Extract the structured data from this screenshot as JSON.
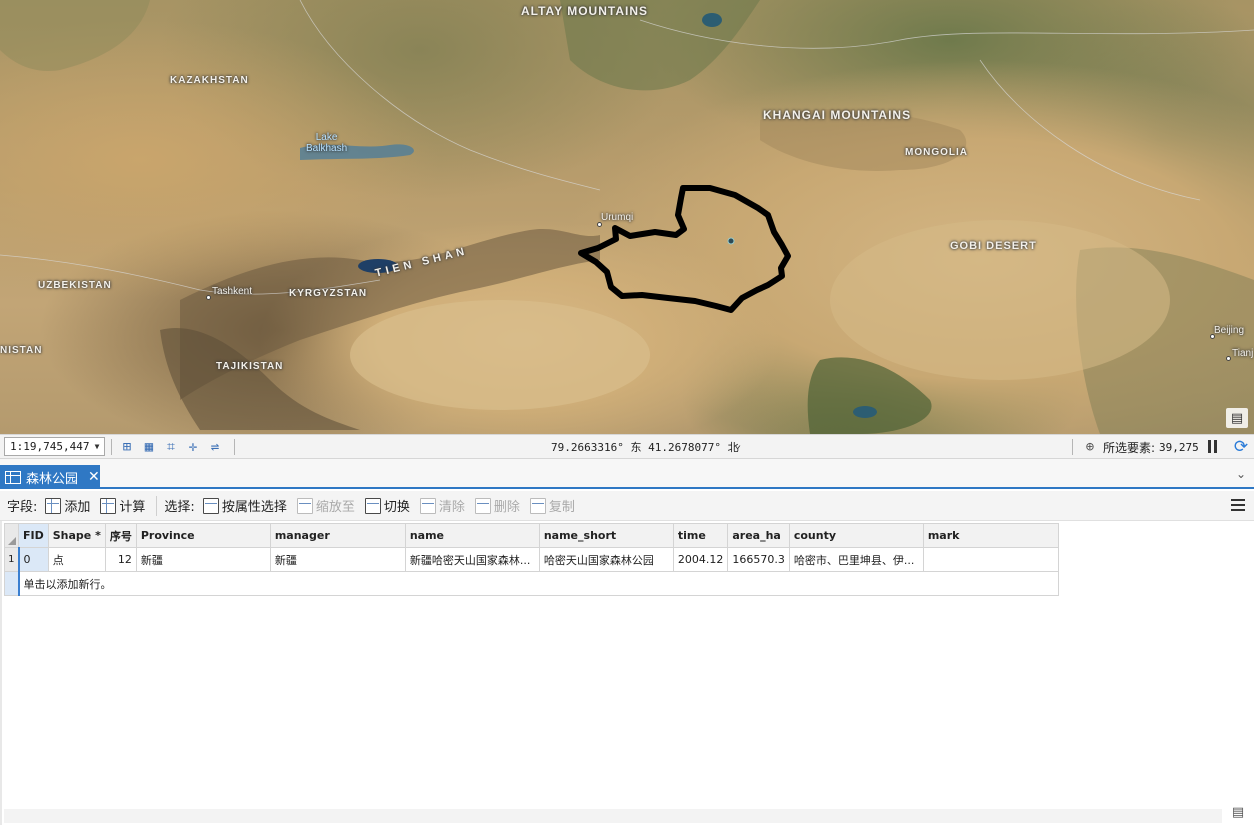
{
  "map": {
    "labels": {
      "altay": "ALTAY MOUNTAINS",
      "kazakhstan": "KAZAKHSTAN",
      "lake_balkhash": "Lake\nBalkhash",
      "khangai": "KHANGAI MOUNTAINS",
      "mongolia": "MONGOLIA",
      "urumqi": "Urumqi",
      "gobi": "GOBI DESERT",
      "uzbekistan": "UZBEKISTAN",
      "tashkent": "Tashkent",
      "kyrgyzstan": "KYRGYZSTAN",
      "tien_shan": "TIEN SHAN",
      "nistan": "NISTAN",
      "tajikistan": "TAJIKISTAN",
      "beijing": "Beijing",
      "tianjin": "Tianj"
    },
    "corner_icon": "table-view-icon",
    "polygon_color": "#000000"
  },
  "status_bar": {
    "scale": "1:19,745,447",
    "coordinates": "79.2663316° 东 41.2678077° 北",
    "selected_label": "所选要素:",
    "selected_count": "39,275",
    "icons": [
      "extent-icon",
      "grid-icon",
      "snapping-icon",
      "crosshair-icon",
      "measure-icon"
    ]
  },
  "tab": {
    "title": "森林公园",
    "close": "✕"
  },
  "toolbar": {
    "fields_label": "字段:",
    "add": "添加",
    "calculate": "计算",
    "select_label": "选择:",
    "select_by_attr": "按属性选择",
    "zoom_to": "缩放至",
    "switch": "切换",
    "clear": "清除",
    "delete": "删除",
    "copy": "复制"
  },
  "table": {
    "columns": [
      "FID",
      "Shape *",
      "序号",
      "Province",
      "manager",
      "name",
      "name_short",
      "time",
      "area_ha",
      "county",
      "mark"
    ],
    "rows": [
      {
        "rownum": "1",
        "FID": "0",
        "Shape": "点",
        "seq": "12",
        "Province": "新疆",
        "manager": "新疆",
        "name": "新疆哈密天山国家森林...",
        "name_short": "哈密天山国家森林公园",
        "time": "2004.12",
        "area_ha": "166570.3",
        "county": "哈密市、巴里坤县、伊...",
        "mark": ""
      }
    ],
    "new_row_text": "单击以添加新行。"
  }
}
